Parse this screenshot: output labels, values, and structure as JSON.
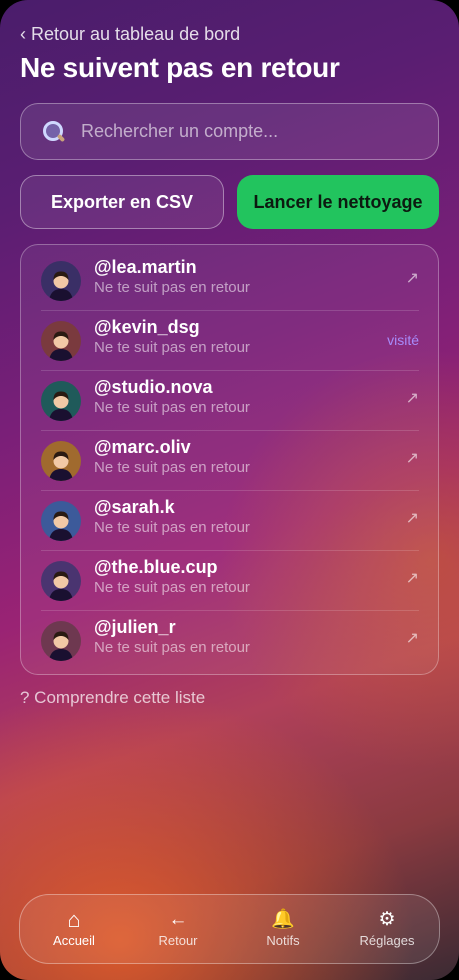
{
  "header": {
    "back_label": "‹ Retour au tableau de bord",
    "title": "Ne suivent pas en retour"
  },
  "search": {
    "placeholder": "Rechercher un compte...",
    "value": ""
  },
  "actions": {
    "export_label": "Exporter en CSV",
    "clean_label": "Lancer le nettoyage",
    "clean_color": "#22c45e"
  },
  "accounts": [
    {
      "handle": "@lea.martin",
      "status": "Ne te suit pas en retour",
      "action": "↗",
      "avatar_bg": "#3a2f66"
    },
    {
      "handle": "@kevin_dsg",
      "status": "Ne te suit pas en retour",
      "action": "visité",
      "avatar_bg": "#7a3a3e"
    },
    {
      "handle": "@studio.nova",
      "status": "Ne te suit pas en retour",
      "action": "↗",
      "avatar_bg": "#1f5a5a"
    },
    {
      "handle": "@marc.oliv",
      "status": "Ne te suit pas en retour",
      "action": "↗",
      "avatar_bg": "#a06a2e"
    },
    {
      "handle": "@sarah.k",
      "status": "Ne te suit pas en retour",
      "action": "↗",
      "avatar_bg": "#3c5a9a"
    },
    {
      "handle": "@the.blue.cup",
      "status": "Ne te suit pas en retour",
      "action": "↗",
      "avatar_bg": "#4a3470"
    },
    {
      "handle": "@julien_r",
      "status": "Ne te suit pas en retour",
      "action": "↗",
      "avatar_bg": "#6e3850"
    }
  ],
  "help": {
    "label": "? Comprendre cette liste"
  },
  "nav": {
    "items": [
      {
        "icon": "⌂",
        "label": "Accueil",
        "icon_name": "home-icon"
      },
      {
        "icon": "←",
        "label": "Retour",
        "icon_name": "back-arrow-icon"
      },
      {
        "icon": "🔔",
        "label": "Notifs",
        "icon_name": "bell-icon"
      },
      {
        "icon": "⚙",
        "label": "Réglages",
        "icon_name": "gear-icon"
      }
    ]
  }
}
